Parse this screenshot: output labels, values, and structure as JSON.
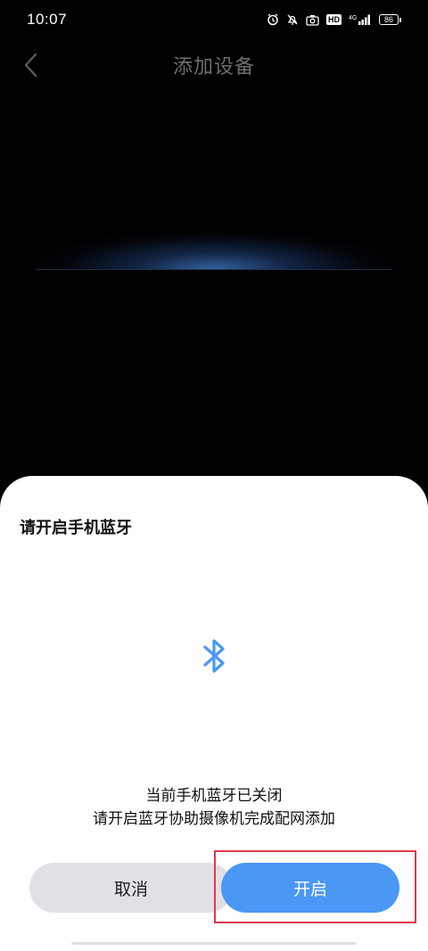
{
  "status_bar": {
    "time": "10:07",
    "network": "4G",
    "hd_label": "HD",
    "battery_level": "86",
    "icons": [
      "alarm-icon",
      "mute-icon",
      "camera-icon",
      "hd-icon",
      "signal-icon",
      "battery-icon"
    ]
  },
  "header": {
    "title": "添加设备",
    "back_icon": "chevron-left-icon"
  },
  "dialog": {
    "title": "请开启手机蓝牙",
    "icon": "bluetooth-icon",
    "message_line1": "当前手机蓝牙已关闭",
    "message_line2": "请开启蓝牙协助摄像机完成配网添加",
    "cancel_label": "取消",
    "confirm_label": "开启"
  },
  "colors": {
    "accent": "#4a97f4",
    "highlight": "#e0384f",
    "cancel_bg": "#e0e0e6"
  }
}
